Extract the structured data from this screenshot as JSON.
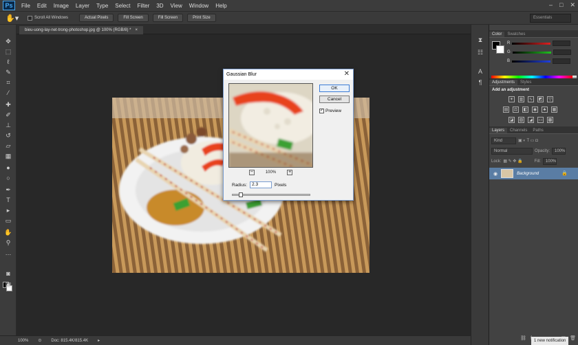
{
  "menu": [
    "File",
    "Edit",
    "Image",
    "Layer",
    "Type",
    "Select",
    "Filter",
    "3D",
    "View",
    "Window",
    "Help"
  ],
  "app_logo": "Ps",
  "window_controls": [
    "–",
    "□",
    "✕"
  ],
  "options": {
    "scroll_all": "Scroll All Windows",
    "buttons": [
      "Actual Pixels",
      "Fill Screen",
      "Fill Screen",
      "Print Size"
    ],
    "workspace": "Essentials"
  },
  "document": {
    "tab_title": "bieu-uong-lay-net-trong-photoshop.jpg @ 100% (RGB/8) *",
    "tab_close": "×"
  },
  "status": {
    "zoom": "100%",
    "doc": "Doc: 815.4K/815.4K",
    "notification": "1 new notification"
  },
  "color_panel": {
    "tabs": [
      "Color",
      "Swatches"
    ],
    "channels": [
      {
        "label": "R",
        "color": "#e02020"
      },
      {
        "label": "G",
        "color": "#20c020"
      },
      {
        "label": "B",
        "color": "#2040e0"
      }
    ]
  },
  "adjustments": {
    "tabs": [
      "Adjustments",
      "Styles"
    ],
    "title": "Add an adjustment"
  },
  "layers": {
    "tabs": [
      "Layers",
      "Channels",
      "Paths"
    ],
    "kind": "Kind",
    "blend_mode": "Normal",
    "opacity_label": "Opacity:",
    "opacity": "100%",
    "lock_label": "Lock:",
    "fill_label": "Fill:",
    "fill": "100%",
    "layer_name": "Background"
  },
  "dialog": {
    "title": "Gaussian Blur",
    "ok": "OK",
    "cancel": "Cancel",
    "preview": "Preview",
    "preview_checked": true,
    "zoom": "100%",
    "radius_label": "Radius:",
    "radius_value": "2.3",
    "radius_unit": "Pixels",
    "radius_fraction": 0.08
  }
}
